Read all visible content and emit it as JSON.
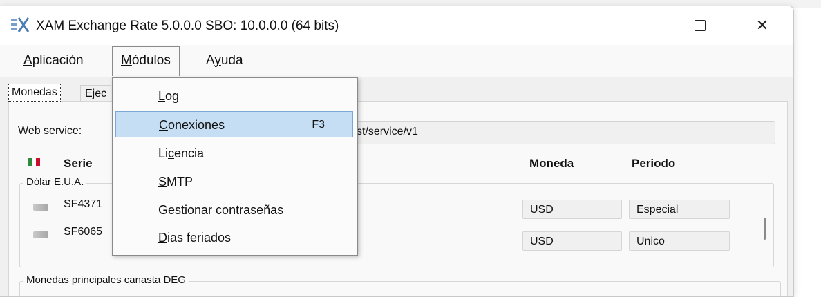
{
  "window": {
    "title": "XAM Exchange Rate 5.0.0.0 SBO: 10.0.0.0 (64 bits)",
    "minimize": "—",
    "maximize": "□",
    "close": "✕"
  },
  "menubar": {
    "aplicacion": {
      "first": "A",
      "rest": "plicación"
    },
    "modulos": {
      "first": "M",
      "rest": "ódulos"
    },
    "ayuda": {
      "pre": "A",
      "u": "y",
      "rest": "uda"
    }
  },
  "dropdown": {
    "items": [
      {
        "pre": "",
        "u": "L",
        "rest": "og",
        "shortcut": ""
      },
      {
        "pre": "",
        "u": "C",
        "rest": "onexiones",
        "shortcut": "F3",
        "highlighted": true
      },
      {
        "pre": "Li",
        "u": "c",
        "rest": "encia",
        "shortcut": ""
      },
      {
        "pre": "",
        "u": "S",
        "rest": "MTP",
        "shortcut": ""
      },
      {
        "pre": "",
        "u": "G",
        "rest": "estionar contraseñas",
        "shortcut": ""
      },
      {
        "pre": "",
        "u": "D",
        "rest": "ias feriados",
        "shortcut": ""
      }
    ]
  },
  "tabs": [
    "Monedas",
    "Ejec"
  ],
  "webservice": {
    "label": "Web service:",
    "value": "st/service/v1"
  },
  "headers": {
    "serie": "Serie",
    "moneda": "Moneda",
    "periodo": "Periodo"
  },
  "groups": [
    {
      "label": "Dólar E.U.A.",
      "rows": [
        {
          "serie": "SF4371",
          "moneda": "USD",
          "periodo": "Especial"
        },
        {
          "serie": "SF6065",
          "moneda": "USD",
          "periodo": "Unico"
        }
      ]
    },
    {
      "label": "Monedas principales canasta DEG",
      "rows": []
    }
  ],
  "colors": {
    "highlight": "#c5def3",
    "flag_green": "#2e8b3e",
    "flag_red": "#c8102e"
  }
}
